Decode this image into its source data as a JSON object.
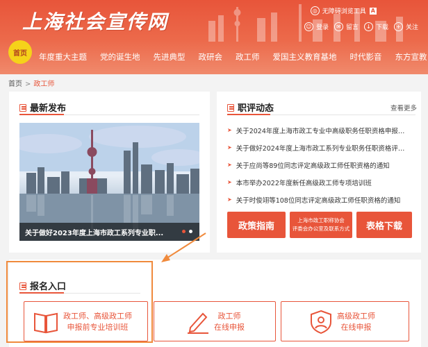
{
  "site": {
    "logo_text": "上海社会宣传网"
  },
  "tools": {
    "accessibility_label": "无障碍浏览工具",
    "a_badge": "A"
  },
  "user_menu": [
    {
      "label": "登录",
      "icon": "user-icon"
    },
    {
      "label": "留言",
      "icon": "message-icon"
    },
    {
      "label": "下载",
      "icon": "download-icon"
    },
    {
      "label": "关注",
      "icon": "plus-icon"
    }
  ],
  "nav": {
    "home": "首页",
    "items": [
      "年度重大主题",
      "党的诞生地",
      "先进典型",
      "政研会",
      "政工师",
      "爱国主义教育基地",
      "时代影音",
      "东方宣教"
    ]
  },
  "breadcrumb": {
    "home": "首页",
    "sep": ">",
    "current": "政工师"
  },
  "latest": {
    "title": "最新发布",
    "caption": "关于做好2023年度上海市政工系列专业职...",
    "slides": 2,
    "active_slide": 0
  },
  "news": {
    "title": "职评动态",
    "more": "查看更多",
    "items": [
      "关于2024年度上海市政工专业中高级职务任职资格申报前...",
      "关于做好2024年度上海市政工系列专业职务任职资格评审...",
      "关于应尚等89位同志评定高级政工师任职资格的通知",
      "本市举办2022年度新任高级政工师专项培训班",
      "关于时俊翊等108位同志评定高级政工师任职资格的通知"
    ],
    "buttons": {
      "policy": "政策指南",
      "committee_line1": "上海市政工职称协会",
      "committee_line2": "评委会办公室及联系方式",
      "forms": "表格下载"
    }
  },
  "registration": {
    "title": "报名入口",
    "cards": [
      {
        "line1": "政工师、高级政工师",
        "line2": "申报前专业培训班",
        "icon": "book-icon"
      },
      {
        "line1": "政工师",
        "line2": "在线申报",
        "icon": "pen-icon"
      },
      {
        "line1": "高级政工师",
        "line2": "在线申报",
        "icon": "shield-user-icon"
      }
    ]
  },
  "colors": {
    "accent": "#e8553a",
    "highlight": "#f08a3c",
    "home_badge": "#f5d21a"
  }
}
